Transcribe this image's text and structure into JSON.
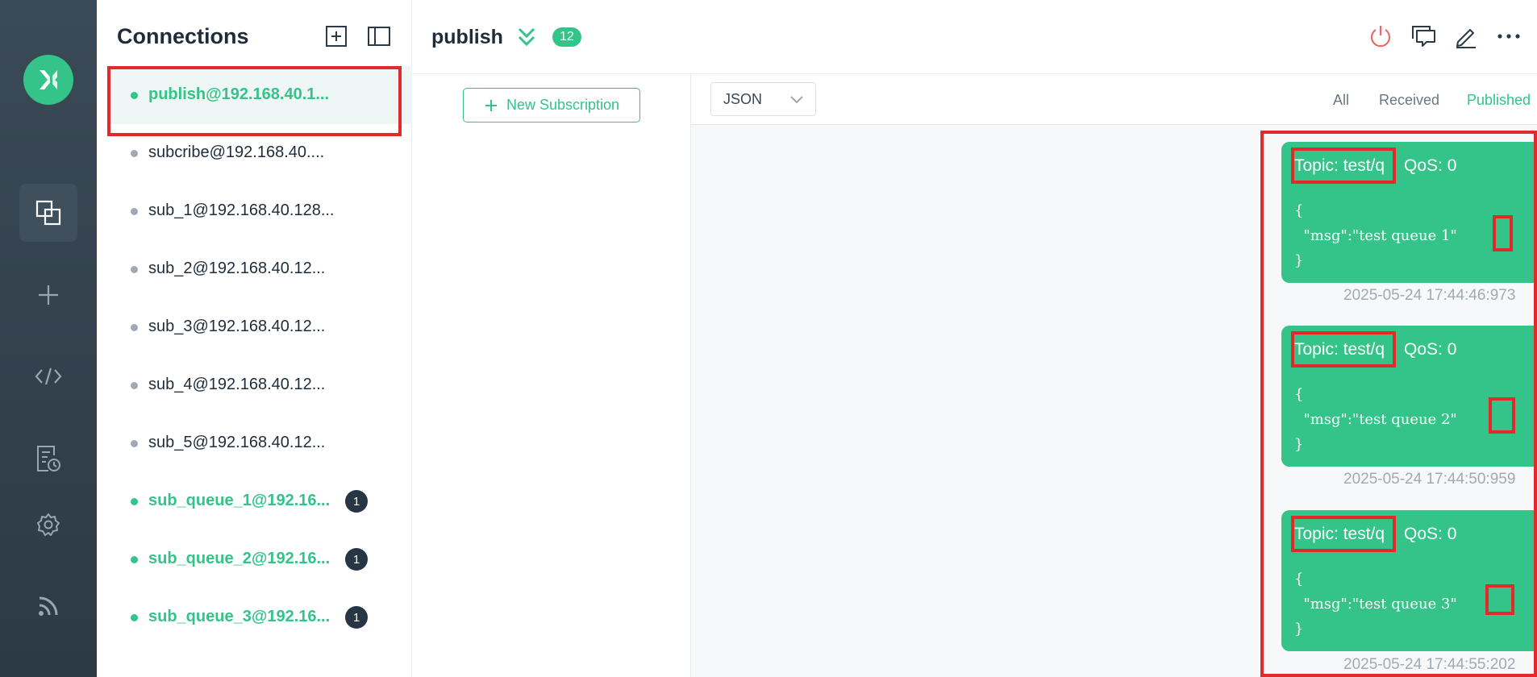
{
  "sidebar": {
    "nav": [
      "connections",
      "new-connection",
      "script",
      "log",
      "settings",
      "subscribe-feed"
    ]
  },
  "connections": {
    "title": "Connections",
    "items": [
      {
        "label": "publish@192.168.40.1...",
        "online": true,
        "badge": ""
      },
      {
        "label": "subcribe@192.168.40....",
        "online": false,
        "badge": ""
      },
      {
        "label": "sub_1@192.168.40.128...",
        "online": false,
        "badge": ""
      },
      {
        "label": "sub_2@192.168.40.12...",
        "online": false,
        "badge": ""
      },
      {
        "label": "sub_3@192.168.40.12...",
        "online": false,
        "badge": ""
      },
      {
        "label": "sub_4@192.168.40.12...",
        "online": false,
        "badge": ""
      },
      {
        "label": "sub_5@192.168.40.12...",
        "online": false,
        "badge": ""
      },
      {
        "label": "sub_queue_1@192.16...",
        "online": true,
        "badge": "1"
      },
      {
        "label": "sub_queue_2@192.16...",
        "online": true,
        "badge": "1"
      },
      {
        "label": "sub_queue_3@192.16...",
        "online": true,
        "badge": "1"
      }
    ]
  },
  "header": {
    "connection_name": "publish",
    "message_count": "12"
  },
  "subscriptions": {
    "new_button_label": "New Subscription"
  },
  "message_toolbar": {
    "format": "JSON",
    "filters": {
      "all": "All",
      "received": "Received",
      "published": "Published"
    },
    "active_filter": "Published"
  },
  "messages": [
    {
      "topic": "Topic: test/q",
      "qos": "QoS: 0",
      "payload": "{\n  \"msg\":\"test queue 1\"\n}",
      "time": "2025-05-24 17:44:46:973"
    },
    {
      "topic": "Topic: test/q",
      "qos": "QoS: 0",
      "payload": "{\n  \"msg\":\"test queue 2\"\n}",
      "time": "2025-05-24 17:44:50:959"
    },
    {
      "topic": "Topic: test/q",
      "qos": "QoS: 0",
      "payload": "{\n  \"msg\":\"test queue 3\"\n}",
      "time": "2025-05-24 17:44:55:202"
    }
  ],
  "colors": {
    "accent": "#34c388",
    "highlight": "#e32a2a",
    "rail": "#2c3a45"
  }
}
